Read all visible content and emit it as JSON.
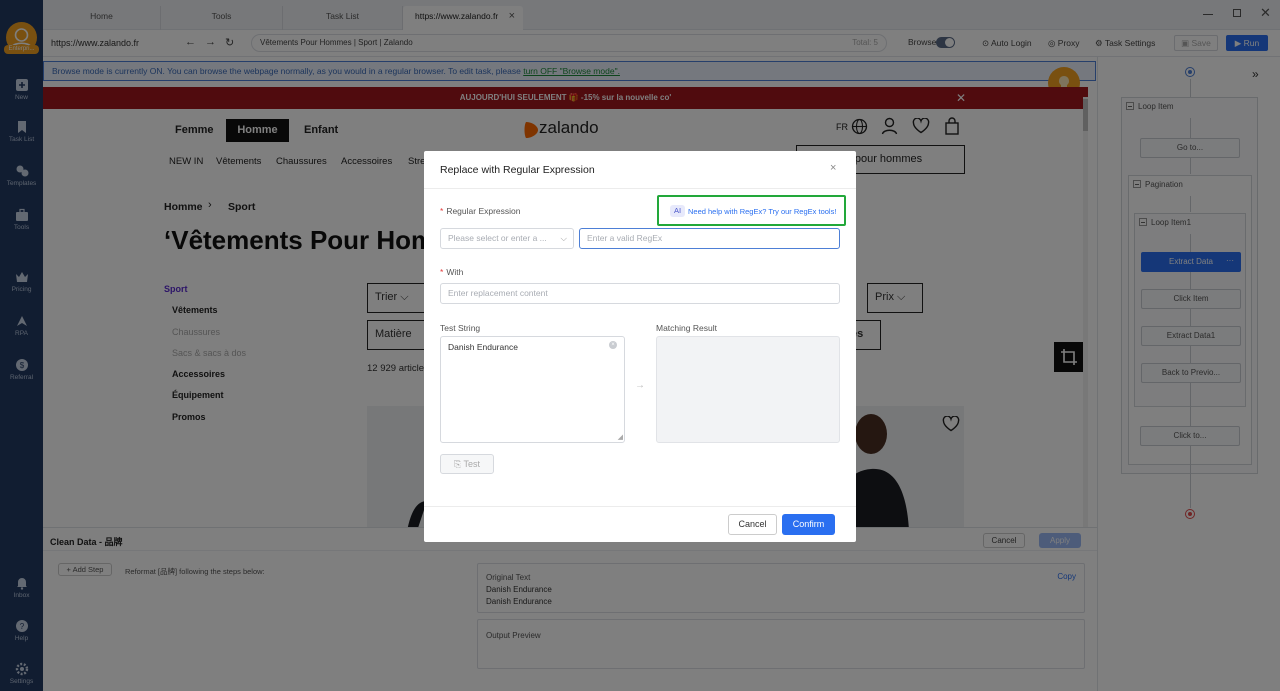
{
  "app": {
    "user_badge": "Enterpri..."
  },
  "nav": [
    {
      "label": "New",
      "icon": "plus-square-icon"
    },
    {
      "label": "Task List",
      "icon": "bookmark-icon"
    },
    {
      "label": "Templates",
      "icon": "templates-icon"
    },
    {
      "label": "Tools",
      "icon": "toolbox-icon"
    },
    {
      "label": "Pricing",
      "icon": "crown-icon"
    },
    {
      "label": "RPA",
      "icon": "rpa-icon"
    },
    {
      "label": "Referral",
      "icon": "dollar-icon"
    },
    {
      "label": "Inbox",
      "icon": "bell-icon"
    },
    {
      "label": "Help",
      "icon": "question-icon"
    },
    {
      "label": "Settings",
      "icon": "gear-icon"
    }
  ],
  "tabs": [
    "Home",
    "Tools",
    "Task List",
    "https://www.zalando.fr"
  ],
  "address": {
    "url": "https://www.zalando.fr",
    "page_title": "Vêtements Pour Hommes | Sport | Zalando",
    "total": "Total: 5"
  },
  "toolbar": {
    "browse": "Browse",
    "auto_login": "Auto Login",
    "proxy": "Proxy",
    "task_settings": "Task Settings",
    "save": "Save",
    "run": "Run"
  },
  "banner": {
    "text": "Browse mode is currently ON. You can browse the webpage normally, as you would in a regular browser. To edit task, please ",
    "link": "turn OFF \"Browse mode\"."
  },
  "site": {
    "promo": "AUJOURD'HUI SEULEMENT 🎁 -15% sur la nouvelle co'",
    "gender_tabs": [
      "Femme",
      "Homme",
      "Enfant"
    ],
    "logo": "zalando",
    "lang": "FR",
    "menu": [
      "NEW IN",
      "Vêtements",
      "Chaussures",
      "Accessoires",
      "Stre"
    ],
    "search_hint": "ents pour hommes",
    "breadcrumb": [
      "Homme",
      "Sport"
    ],
    "heading": "‘Vêtements Pour Hom",
    "sidebar": [
      "Sport",
      "Vêtements",
      "Chaussures",
      "Sacs & sacs à dos",
      "Accessoires",
      "Équipement",
      "Promos"
    ],
    "filters": [
      "Trier",
      "Prix",
      "Matière",
      "ures"
    ],
    "count": "12 929 article"
  },
  "modal": {
    "title": "Replace with Regular Expression",
    "regex_label": "Regular Expression",
    "ai_badge": "AI",
    "ai_help": "Need help with RegEx? Try our RegEx tools!",
    "select_placeholder": "Please select or enter a ...",
    "regex_placeholder": "Enter a valid RegEx",
    "with_label": "With",
    "with_placeholder": "Enter replacement content",
    "test_string_label": "Test String",
    "test_string_value": "Danish Endurance",
    "matching_label": "Matching Result",
    "test_button": "Test",
    "cancel": "Cancel",
    "confirm": "Confirm"
  },
  "clean": {
    "title": "Clean Data - 品牌",
    "cancel": "Cancel",
    "apply": "Apply",
    "add_step": "+ Add Step",
    "reformat": "Reformat [品牌] following the steps below:",
    "original_label": "Original Text",
    "copy": "Copy",
    "original_values": [
      "Danish Endurance",
      "Danish Endurance"
    ],
    "output_label": "Output Preview"
  },
  "workflow": {
    "loop_item": "Loop Item",
    "go_to": "Go to...",
    "pagination": "Pagination",
    "loop_item1": "Loop Item1",
    "extract_data": "Extract Data",
    "click_item": "Click Item",
    "extract_data1": "Extract Data1",
    "back_to_prev": "Back to Previo...",
    "click_to": "Click to..."
  },
  "colors": {
    "nav_bg": "#233b63",
    "accent": "#2a6ff0",
    "highlight": "#22a83a",
    "promo_bg": "#a0161c",
    "zalando": "#ff6900"
  }
}
